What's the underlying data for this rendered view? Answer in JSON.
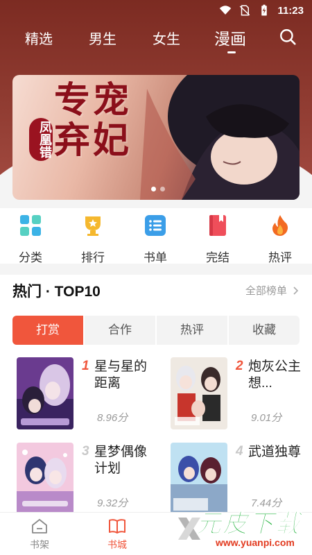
{
  "status_bar": {
    "time": "11:23"
  },
  "top_nav": {
    "tabs": [
      "精选",
      "男生",
      "女生",
      "漫画"
    ],
    "active_index": 3
  },
  "banner": {
    "title_line1": "专宠",
    "title_line2": "弃妃",
    "subtitle": "凤凰错",
    "slide_count": 2,
    "active_slide": 0
  },
  "categories": [
    {
      "label": "分类",
      "icon": "grid-icon",
      "color": "#3cb3e6"
    },
    {
      "label": "排行",
      "icon": "trophy-icon",
      "color": "#f5b82e"
    },
    {
      "label": "书单",
      "icon": "list-icon",
      "color": "#3b9ee8"
    },
    {
      "label": "完结",
      "icon": "book-icon",
      "color": "#ef4e5a"
    },
    {
      "label": "热评",
      "icon": "flame-icon",
      "color": "#f26a22"
    }
  ],
  "section": {
    "title": "热门 · TOP10",
    "more": "全部榜单"
  },
  "rank_tabs": [
    "打赏",
    "合作",
    "热评",
    "收藏"
  ],
  "rank_tabs_active": 0,
  "books": [
    {
      "rank": "1",
      "title": "星与星的距离",
      "score": "8.96分"
    },
    {
      "rank": "2",
      "title": "炮灰公主想...",
      "score": "9.01分"
    },
    {
      "rank": "3",
      "title": "星梦偶像计划",
      "score": "9.32分"
    },
    {
      "rank": "4",
      "title": "武道独尊",
      "score": "7.44分"
    }
  ],
  "bottom_bar": {
    "items": [
      "书架",
      "书城"
    ],
    "active_index": 1
  },
  "watermark": {
    "main": "元皮下载",
    "url": "www.yuanpi.com"
  },
  "colors": {
    "accent": "#f0563c",
    "rank_top": "#f0563c",
    "rank_low": "#c8c8c8"
  }
}
